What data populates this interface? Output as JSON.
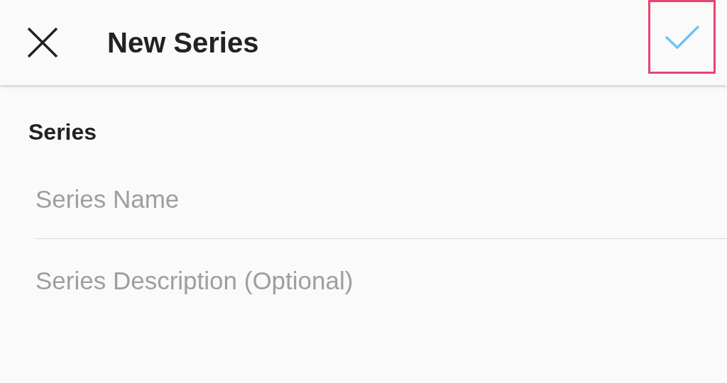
{
  "header": {
    "title": "New Series",
    "confirm": {
      "highlighted": true
    }
  },
  "section": {
    "title": "Series"
  },
  "fields": [
    {
      "placeholder": "Series Name"
    },
    {
      "placeholder": "Series Description (Optional)"
    }
  ]
}
